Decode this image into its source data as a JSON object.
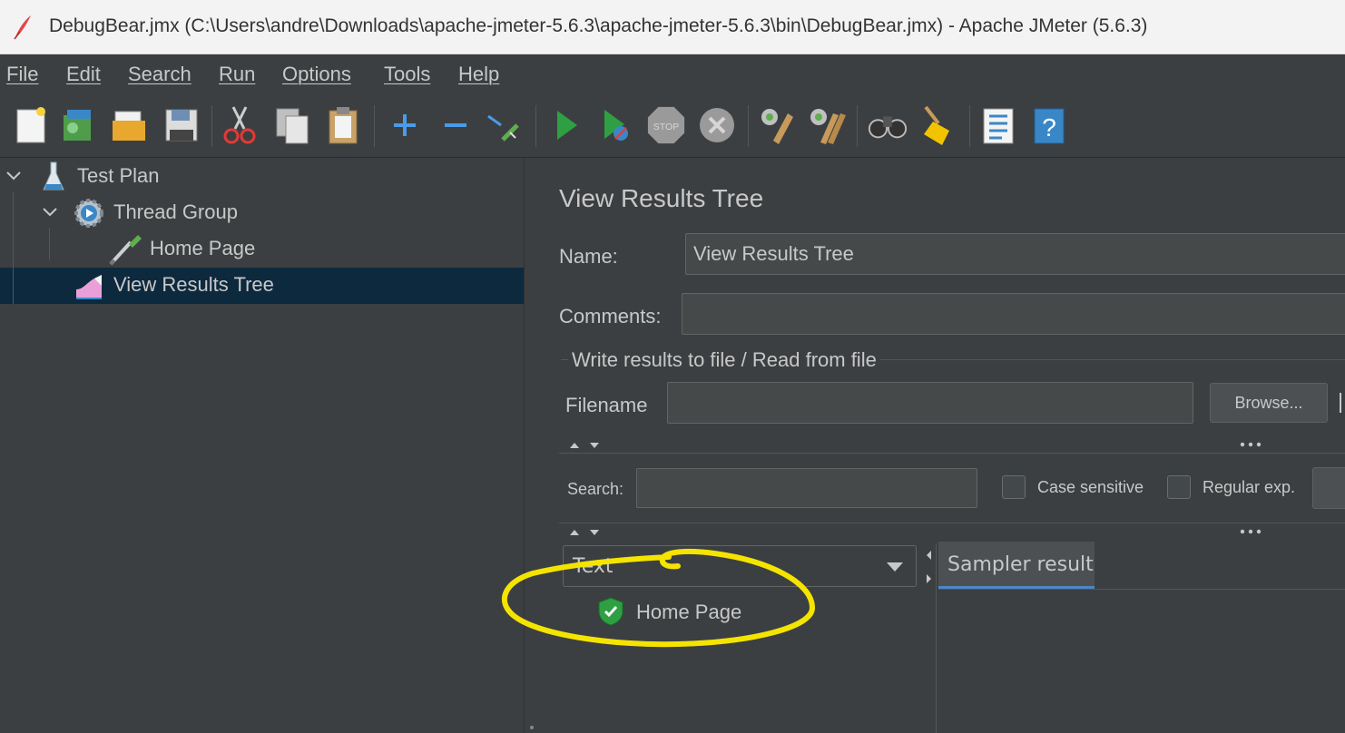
{
  "window": {
    "title": "DebugBear.jmx (C:\\Users\\andre\\Downloads\\apache-jmeter-5.6.3\\apache-jmeter-5.6.3\\bin\\DebugBear.jmx) - Apache JMeter (5.6.3)"
  },
  "menu": {
    "items": [
      {
        "label": "File"
      },
      {
        "label": "Edit"
      },
      {
        "label": "Search"
      },
      {
        "label": "Run"
      },
      {
        "label": "Options"
      },
      {
        "label": "Tools"
      },
      {
        "label": "Help"
      }
    ]
  },
  "toolbar": {
    "buttons": [
      "new-icon",
      "templates-icon",
      "open-icon",
      "save-icon",
      "cut-icon",
      "copy-icon",
      "paste-icon",
      "expand-icon",
      "collapse-icon",
      "toggle-icon",
      "start-icon",
      "start-no-pauses-icon",
      "stop-icon",
      "shutdown-icon",
      "clear-icon",
      "clear-all-icon",
      "search-icon",
      "reset-search-icon",
      "function-helper-icon",
      "help-icon"
    ],
    "stop_label": "STOP"
  },
  "tree": {
    "items": [
      {
        "label": "Test Plan",
        "icon": "flask-icon"
      },
      {
        "label": "Thread Group",
        "icon": "gear-icon"
      },
      {
        "label": "Home Page",
        "icon": "pipette-icon"
      },
      {
        "label": "View Results Tree",
        "icon": "listener-icon",
        "selected": true
      }
    ]
  },
  "panel": {
    "title": "View Results Tree",
    "name_label": "Name:",
    "name_value": "View Results Tree",
    "comments_label": "Comments:",
    "comments_value": "",
    "file_group_label": "Write results to file / Read from file",
    "filename_label": "Filename",
    "filename_value": "",
    "browse_label": "Browse...",
    "search_label": "Search:",
    "search_value": "",
    "case_sensitive_label": "Case sensitive",
    "regular_exp_label": "Regular exp.",
    "renderer_value": "Text",
    "results": [
      {
        "label": "Home Page",
        "status": "success"
      }
    ],
    "tabs": [
      {
        "label": "Sampler result"
      }
    ]
  },
  "colors": {
    "background": "#3c3f41",
    "selection": "#0d293e",
    "annotation": "#f5e400",
    "success": "#2ea043"
  }
}
